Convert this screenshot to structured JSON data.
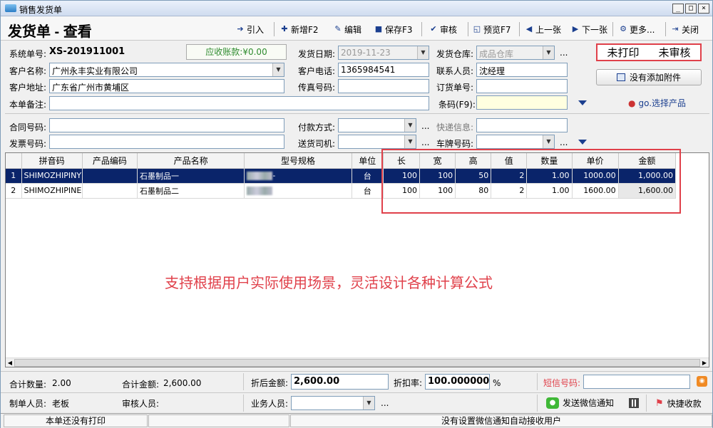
{
  "window": {
    "title": "销售发货单",
    "min": "_",
    "max": "□",
    "close": "×"
  },
  "toolbar": {
    "doc_title": "发货单 - 查看",
    "buttons": [
      "引入",
      "新增F2",
      "编辑",
      "保存F3",
      "审核",
      "预览F7",
      "上一张",
      "下一张",
      "更多...",
      "关闭"
    ]
  },
  "form": {
    "sys_no_label": "系统单号:",
    "sys_no": "XS-201911001",
    "ar_label": "应收账款:",
    "ar_value": "¥0.00",
    "ship_date_label": "发货日期:",
    "ship_date": "2019-11-23",
    "warehouse_label": "发货仓库:",
    "warehouse": "成品仓库",
    "customer_label": "客户名称:",
    "customer": "广州永丰实业有限公司",
    "phone_label": "客户电话:",
    "phone": "1365984541",
    "contact_label": "联系人员:",
    "contact": "沈经理",
    "address_label": "客户地址:",
    "address": "广东省广州市黄埔区",
    "fax_label": "传真号码:",
    "fax": "",
    "order_no_label": "订货单号:",
    "order_no": "",
    "remark_label": "本单备注:",
    "remark": "",
    "barcode_label": "条码(F9):",
    "barcode": "",
    "contract_label": "合同号码:",
    "contract": "",
    "payment_label": "付款方式:",
    "payment": "",
    "express_label": "快递信息:",
    "express": "",
    "invoice_label": "发票号码:",
    "invoice": "",
    "driver_label": "送货司机:",
    "driver": "",
    "plate_label": "车牌号码:",
    "plate": "",
    "print_status": "未打印",
    "audit_status": "未审核",
    "attach_btn": "没有添加附件",
    "go_link": "go.选择产品",
    "dots": "..."
  },
  "grid": {
    "headers": [
      "",
      "拼音码",
      "产品编码",
      "产品名称",
      "型号规格",
      "单位",
      "长",
      "宽",
      "高",
      "值",
      "数量",
      "单价",
      "金额"
    ],
    "rows": [
      {
        "idx": "1",
        "pinyin": "SHIMOZHIPINY",
        "code": "",
        "name": "石墨制品一",
        "spec_suffix": "-",
        "unit": "台",
        "len": "100",
        "wid": "100",
        "hei": "50",
        "val": "2",
        "qty": "1.00",
        "price": "1000.00",
        "amount": "1,000.00"
      },
      {
        "idx": "2",
        "pinyin": "SHIMOZHIPINE",
        "code": "",
        "name": "石墨制品二",
        "spec_suffix": "",
        "unit": "台",
        "len": "100",
        "wid": "100",
        "hei": "80",
        "val": "2",
        "qty": "1.00",
        "price": "1600.00",
        "amount": "1,600.00"
      }
    ]
  },
  "promo_text": "支持根据用户实际使用场景，灵活设计各种计算公式",
  "footer": {
    "total_qty_label": "合计数量:",
    "total_qty": "2.00",
    "total_amt_label": "合计金额:",
    "total_amt": "2,600.00",
    "after_disc_label": "折后金额:",
    "after_disc": "2,600.00",
    "disc_rate_label": "折扣率:",
    "disc_rate": "100.000000",
    "pct": "%",
    "sms_label": "短信号码:",
    "sms": "",
    "maker_label": "制单人员:",
    "maker": "老板",
    "auditor_label": "审核人员:",
    "auditor": "",
    "sales_label": "业务人员:",
    "sales": "",
    "wechat_btn": "发送微信通知",
    "quick_recv_btn": "快捷收款"
  },
  "statusbar": {
    "print": "本单还没有打印",
    "wechat": "没有设置微信通知自动接收用户"
  },
  "colors": {
    "accent_red": "#e0404a",
    "selection": "#0a246a",
    "link_blue": "#1b3f8f"
  }
}
